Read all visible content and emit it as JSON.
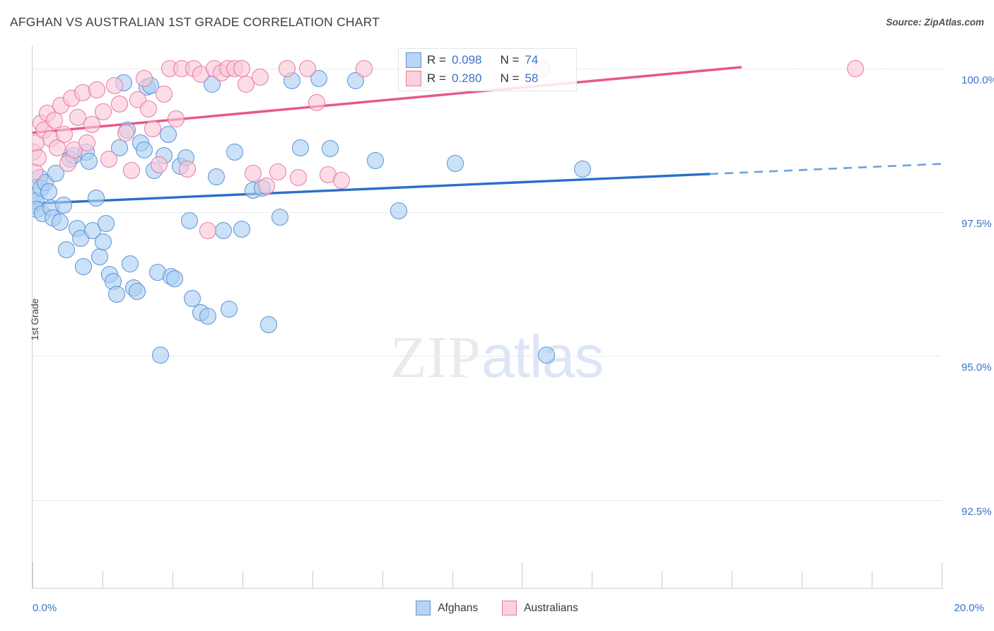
{
  "header": {
    "title": "AFGHAN VS AUSTRALIAN 1ST GRADE CORRELATION CHART",
    "source": "Source: ZipAtlas.com"
  },
  "watermark": {
    "part1": "ZIP",
    "part2": "atlas"
  },
  "stats": {
    "rows": [
      {
        "series": "Afghans",
        "color": "#bad4f3",
        "r_label": "R =",
        "r_value": "0.098",
        "n_label": "N =",
        "n_value": "74"
      },
      {
        "series": "Australians",
        "color": "#fbd1de",
        "r_label": "R =",
        "r_value": "0.280",
        "n_label": "N =",
        "n_value": "58"
      }
    ]
  },
  "legend": {
    "items": [
      {
        "label": "Afghans",
        "color": "#bad4f3",
        "stroke": "#5b93d6"
      },
      {
        "label": "Australians",
        "color": "#fbd1de",
        "stroke": "#e8799e"
      }
    ]
  },
  "chart_data": {
    "type": "scatter",
    "title": "AFGHAN VS AUSTRALIAN 1ST GRADE CORRELATION CHART",
    "xlabel": "",
    "ylabel": "1st Grade",
    "xlim": [
      0,
      20
    ],
    "ylim": [
      91.0,
      100.4
    ],
    "grid": true,
    "legend_position": "bottom-center",
    "xticks": [
      0.0,
      20.0
    ],
    "xtick_labels": [
      "0.0%",
      "20.0%"
    ],
    "yticks": [
      100.0,
      97.5,
      95.0,
      92.5
    ],
    "ytick_labels": [
      "100.0%",
      "97.5%",
      "95.0%",
      "92.5%"
    ],
    "series": [
      {
        "name": "Afghans",
        "color": "#abcef2",
        "stroke": "#5b93d6",
        "r": 0.098,
        "n": 74,
        "trendline": {
          "x0": 0.0,
          "y0": 97.65,
          "x1": 20.0,
          "y1": 98.34,
          "solid_to_x": 14.9
        },
        "points": [
          [
            0.02,
            97.62
          ],
          [
            0.05,
            97.8
          ],
          [
            0.08,
            97.7
          ],
          [
            0.1,
            97.55
          ],
          [
            0.15,
            98.1
          ],
          [
            0.18,
            97.92
          ],
          [
            0.22,
            97.48
          ],
          [
            0.28,
            98.02
          ],
          [
            0.35,
            97.86
          ],
          [
            0.4,
            97.58
          ],
          [
            0.45,
            97.4
          ],
          [
            0.52,
            98.18
          ],
          [
            0.6,
            97.33
          ],
          [
            0.68,
            97.62
          ],
          [
            0.75,
            96.85
          ],
          [
            0.82,
            98.42
          ],
          [
            0.9,
            98.48
          ],
          [
            0.98,
            97.22
          ],
          [
            1.05,
            97.05
          ],
          [
            1.12,
            96.55
          ],
          [
            1.18,
            98.55
          ],
          [
            1.25,
            98.38
          ],
          [
            1.32,
            97.18
          ],
          [
            1.4,
            97.75
          ],
          [
            1.48,
            96.72
          ],
          [
            1.55,
            96.98
          ],
          [
            1.62,
            97.3
          ],
          [
            1.7,
            96.42
          ],
          [
            1.78,
            96.3
          ],
          [
            1.85,
            96.08
          ],
          [
            1.92,
            98.62
          ],
          [
            2.0,
            99.75
          ],
          [
            2.08,
            98.92
          ],
          [
            2.15,
            96.6
          ],
          [
            2.22,
            96.18
          ],
          [
            2.3,
            96.12
          ],
          [
            2.38,
            98.7
          ],
          [
            2.45,
            98.58
          ],
          [
            2.52,
            99.68
          ],
          [
            2.6,
            99.7
          ],
          [
            2.68,
            98.22
          ],
          [
            2.75,
            96.45
          ],
          [
            2.82,
            95.02
          ],
          [
            2.9,
            98.48
          ],
          [
            2.98,
            98.85
          ],
          [
            3.05,
            96.38
          ],
          [
            3.12,
            96.35
          ],
          [
            3.25,
            98.3
          ],
          [
            3.38,
            98.45
          ],
          [
            3.45,
            97.35
          ],
          [
            3.52,
            96.0
          ],
          [
            3.7,
            95.75
          ],
          [
            3.85,
            95.7
          ],
          [
            3.95,
            99.72
          ],
          [
            4.05,
            98.12
          ],
          [
            4.2,
            97.18
          ],
          [
            4.32,
            95.82
          ],
          [
            4.45,
            98.55
          ],
          [
            4.6,
            97.2
          ],
          [
            4.85,
            97.88
          ],
          [
            5.05,
            97.92
          ],
          [
            5.2,
            95.55
          ],
          [
            5.45,
            97.42
          ],
          [
            5.7,
            99.78
          ],
          [
            5.9,
            98.62
          ],
          [
            6.3,
            99.82
          ],
          [
            6.55,
            98.6
          ],
          [
            7.1,
            99.78
          ],
          [
            7.55,
            98.4
          ],
          [
            8.05,
            97.52
          ],
          [
            8.6,
            99.8
          ],
          [
            9.3,
            98.35
          ],
          [
            11.3,
            95.02
          ],
          [
            12.1,
            98.25
          ]
        ]
      },
      {
        "name": "Australians",
        "color": "#fac8d8",
        "stroke": "#e8799e",
        "r": 0.28,
        "n": 58,
        "trendline": {
          "x0": 0.0,
          "y0": 98.88,
          "x1": 15.6,
          "y1": 100.02
        },
        "points": [
          [
            0.02,
            98.55
          ],
          [
            0.05,
            98.2
          ],
          [
            0.08,
            98.7
          ],
          [
            0.12,
            98.45
          ],
          [
            0.18,
            99.05
          ],
          [
            0.25,
            98.92
          ],
          [
            0.32,
            99.22
          ],
          [
            0.4,
            98.78
          ],
          [
            0.48,
            99.1
          ],
          [
            0.55,
            98.62
          ],
          [
            0.62,
            99.35
          ],
          [
            0.7,
            98.85
          ],
          [
            0.78,
            98.35
          ],
          [
            0.85,
            99.48
          ],
          [
            0.92,
            98.58
          ],
          [
            1.0,
            99.15
          ],
          [
            1.1,
            99.58
          ],
          [
            1.2,
            98.7
          ],
          [
            1.3,
            99.02
          ],
          [
            1.42,
            99.62
          ],
          [
            1.55,
            99.25
          ],
          [
            1.68,
            98.42
          ],
          [
            1.8,
            99.7
          ],
          [
            1.92,
            99.38
          ],
          [
            2.05,
            98.88
          ],
          [
            2.18,
            98.22
          ],
          [
            2.32,
            99.45
          ],
          [
            2.45,
            99.82
          ],
          [
            2.55,
            99.3
          ],
          [
            2.65,
            98.95
          ],
          [
            2.78,
            98.32
          ],
          [
            2.9,
            99.55
          ],
          [
            3.02,
            100.0
          ],
          [
            3.15,
            99.12
          ],
          [
            3.28,
            100.0
          ],
          [
            3.4,
            98.25
          ],
          [
            3.55,
            100.0
          ],
          [
            3.7,
            99.9
          ],
          [
            3.85,
            97.18
          ],
          [
            4.0,
            100.0
          ],
          [
            4.15,
            99.92
          ],
          [
            4.3,
            100.0
          ],
          [
            4.45,
            100.0
          ],
          [
            4.6,
            100.0
          ],
          [
            4.7,
            99.72
          ],
          [
            4.85,
            98.18
          ],
          [
            5.0,
            99.85
          ],
          [
            5.15,
            97.95
          ],
          [
            5.4,
            98.2
          ],
          [
            5.6,
            100.0
          ],
          [
            5.85,
            98.1
          ],
          [
            6.05,
            100.0
          ],
          [
            6.25,
            99.4
          ],
          [
            6.5,
            98.15
          ],
          [
            6.8,
            98.05
          ],
          [
            7.3,
            100.0
          ],
          [
            11.2,
            100.0
          ],
          [
            18.1,
            100.0
          ]
        ]
      }
    ]
  }
}
